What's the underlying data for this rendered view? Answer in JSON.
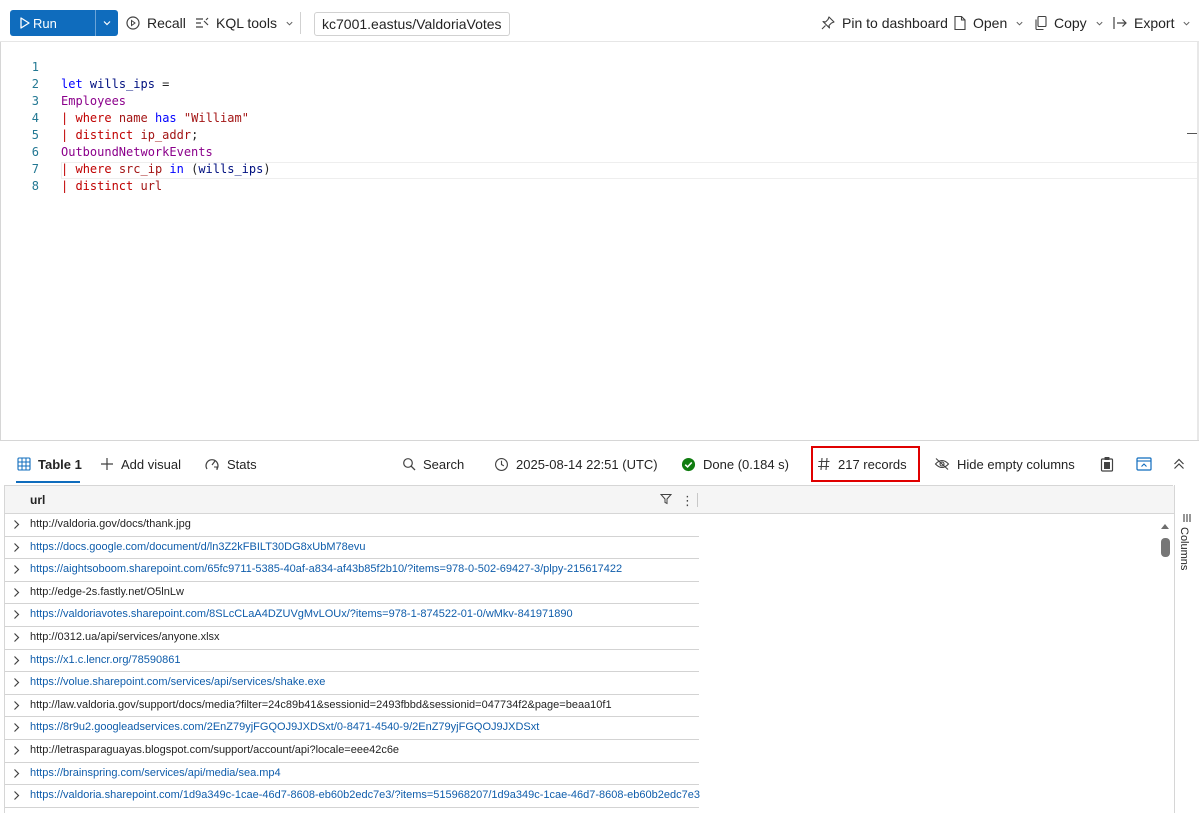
{
  "toolbar": {
    "run_label": "Run",
    "recall_label": "Recall",
    "kql_tools_label": "KQL tools",
    "cluster": "kc7001.eastus/ValdoriaVotes",
    "pin_label": "Pin to dashboard",
    "open_label": "Open",
    "copy_label": "Copy",
    "export_label": "Export"
  },
  "editor": {
    "line_numbers": [
      "1",
      "2",
      "3",
      "4",
      "5",
      "6",
      "7",
      "8"
    ]
  },
  "results": {
    "tab_table": "Table 1",
    "add_visual": "Add visual",
    "stats": "Stats",
    "search": "Search",
    "timestamp": "2025-08-14 22:51 (UTC)",
    "status": "Done (0.184 s)",
    "records": "217 records",
    "hide_empty": "Hide empty columns",
    "columns_panel": "Columns"
  },
  "grid": {
    "column": "url",
    "rows": [
      {
        "url": "http://valdoria.gov/docs/thank.jpg",
        "link": false
      },
      {
        "url": "https://docs.google.com/document/d/ln3Z2kFBILT30DG8xUbM78evu",
        "link": true
      },
      {
        "url": "https://aightsoboom.sharepoint.com/65fc9711-5385-40af-a834-af43b85f2b10/?items=978-0-502-69427-3/plpy-215617422",
        "link": true
      },
      {
        "url": "http://edge-2s.fastly.net/O5lnLw",
        "link": false
      },
      {
        "url": "https://valdoriavotes.sharepoint.com/8SLcCLaA4DZUVgMvLOUx/?items=978-1-874522-01-0/wMkv-841971890",
        "link": true
      },
      {
        "url": "http://0312.ua/api/services/anyone.xlsx",
        "link": false
      },
      {
        "url": "https://x1.c.lencr.org/78590861",
        "link": true
      },
      {
        "url": "https://volue.sharepoint.com/services/api/services/shake.exe",
        "link": true
      },
      {
        "url": "http://law.valdoria.gov/support/docs/media?filter=24c89b41&sessionid=2493fbbd&sessionid=047734f2&page=beaa10f1",
        "link": false
      },
      {
        "url": "https://8r9u2.googleadservices.com/2EnZ79yjFGQOJ9JXDSxt/0-8471-4540-9/2EnZ79yjFGQOJ9JXDSxt",
        "link": true
      },
      {
        "url": "http://letrasparaguayas.blogspot.com/support/account/api?locale=eee42c6e",
        "link": false
      },
      {
        "url": "https://brainspring.com/services/api/media/sea.mp4",
        "link": true
      },
      {
        "url": "https://valdoria.sharepoint.com/1d9a349c-1cae-46d7-8608-eb60b2edc7e3/?items=515968207/1d9a349c-1cae-46d7-8608-eb60b2edc7e3",
        "link": true
      }
    ]
  },
  "colors": {
    "accent": "#0f6cbd",
    "highlight": "#e00000",
    "success": "#107c10"
  }
}
